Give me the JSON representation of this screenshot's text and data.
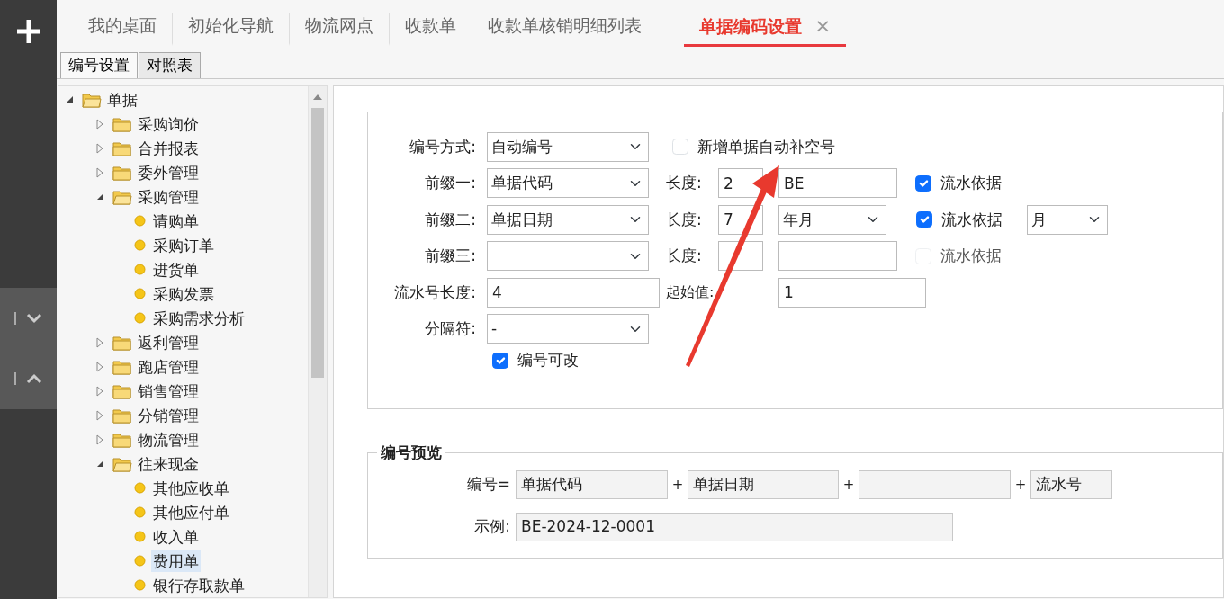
{
  "tabs": [
    {
      "label": "我的桌面",
      "selected": false
    },
    {
      "label": "初始化导航",
      "selected": false
    },
    {
      "label": "物流网点",
      "selected": false
    },
    {
      "label": "收款单",
      "selected": false
    },
    {
      "label": "收款单核销明细列表",
      "selected": false
    },
    {
      "label": "单据编码设置",
      "selected": true,
      "close": "×"
    }
  ],
  "subtabs": [
    {
      "label": "编号设置",
      "selected": true
    },
    {
      "label": "对照表",
      "selected": false
    }
  ],
  "tree": [
    {
      "label": "单据",
      "kind": "folder",
      "expanded": true,
      "selected": false,
      "children": [
        {
          "label": "采购询价",
          "kind": "folder",
          "expanded": false,
          "selected": false
        },
        {
          "label": "合并报表",
          "kind": "folder",
          "expanded": false,
          "selected": false
        },
        {
          "label": "委外管理",
          "kind": "folder",
          "expanded": false,
          "selected": false
        },
        {
          "label": "采购管理",
          "kind": "folder",
          "expanded": true,
          "selected": false,
          "children": [
            {
              "label": "请购单",
              "kind": "doc",
              "selected": false
            },
            {
              "label": "采购订单",
              "kind": "doc",
              "selected": false
            },
            {
              "label": "进货单",
              "kind": "doc",
              "selected": false
            },
            {
              "label": "采购发票",
              "kind": "doc",
              "selected": false
            },
            {
              "label": "采购需求分析",
              "kind": "doc",
              "selected": false
            }
          ]
        },
        {
          "label": "返利管理",
          "kind": "folder",
          "expanded": false,
          "selected": false
        },
        {
          "label": "跑店管理",
          "kind": "folder",
          "expanded": false,
          "selected": false
        },
        {
          "label": "销售管理",
          "kind": "folder",
          "expanded": false,
          "selected": false
        },
        {
          "label": "分销管理",
          "kind": "folder",
          "expanded": false,
          "selected": false
        },
        {
          "label": "物流管理",
          "kind": "folder",
          "expanded": false,
          "selected": false
        },
        {
          "label": "往来现金",
          "kind": "folder",
          "expanded": true,
          "selected": false,
          "children": [
            {
              "label": "其他应收单",
              "kind": "doc",
              "selected": false
            },
            {
              "label": "其他应付单",
              "kind": "doc",
              "selected": false
            },
            {
              "label": "收入单",
              "kind": "doc",
              "selected": false
            },
            {
              "label": "费用单",
              "kind": "doc",
              "selected": true
            },
            {
              "label": "银行存取款单",
              "kind": "doc",
              "selected": false
            }
          ]
        }
      ]
    }
  ],
  "numbering": {
    "mode": {
      "label": "编号方式:",
      "value": "自动编号"
    },
    "fill_gaps": {
      "label": "新增单据自动补空号",
      "checked": false
    },
    "prefixes": [
      {
        "label": "前缀一:",
        "value": "单据代码",
        "length_label": "长度:",
        "length": "2",
        "extra": {
          "kind": "input",
          "value": "BE"
        },
        "basis": {
          "label": "流水依据",
          "checked": true,
          "disabled": false
        }
      },
      {
        "label": "前缀二:",
        "value": "单据日期",
        "length_label": "长度:",
        "length": "7",
        "extra": {
          "kind": "select",
          "value": "年月"
        },
        "basis": {
          "label": "流水依据",
          "checked": true,
          "disabled": false,
          "period": "月"
        }
      },
      {
        "label": "前缀三:",
        "length_label": "长度:",
        "extra": {
          "kind": "input"
        },
        "basis": {
          "label": "流水依据",
          "checked": false,
          "disabled": true
        }
      }
    ],
    "serial_length": {
      "label": "流水号长度:",
      "value": "4"
    },
    "start": {
      "label": "起始值:",
      "value": "1"
    },
    "separator": {
      "label": "分隔符:",
      "value": "-"
    },
    "editable": {
      "label": "编号可改",
      "checked": true
    }
  },
  "preview": {
    "title": "编号预览",
    "formula_label": "编号=",
    "parts": [
      {
        "value": "单据代码"
      },
      {
        "plus": "+",
        "value": "单据日期"
      },
      {
        "plus": "+"
      },
      {
        "plus": "+",
        "value": "流水号"
      }
    ],
    "example_label": "示例:",
    "example": "BE-2024-12-0001"
  }
}
